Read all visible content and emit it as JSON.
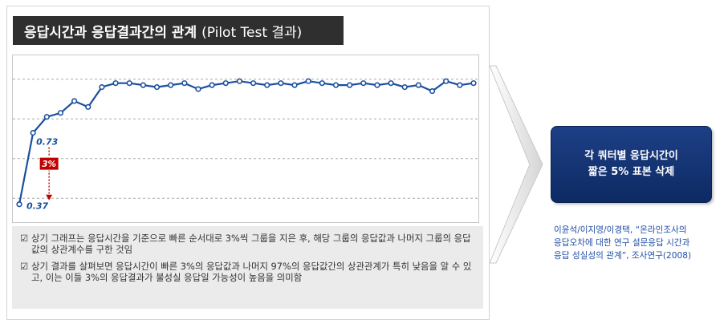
{
  "title": {
    "main": "응답시간과 응답결과간의 관계",
    "sub": "(Pilot Test 결과)"
  },
  "chart_data": {
    "type": "line",
    "x": [
      1,
      2,
      3,
      4,
      5,
      6,
      7,
      8,
      9,
      10,
      11,
      12,
      13,
      14,
      15,
      16,
      17,
      18,
      19,
      20,
      21,
      22,
      23,
      24,
      25,
      26,
      27,
      28,
      29,
      30,
      31,
      32,
      33,
      34
    ],
    "series": [
      {
        "values": [
          0.37,
          0.73,
          0.81,
          0.83,
          0.89,
          0.86,
          0.96,
          0.98,
          0.98,
          0.97,
          0.96,
          0.97,
          0.98,
          0.95,
          0.97,
          0.98,
          0.99,
          0.98,
          0.97,
          0.98,
          0.97,
          0.99,
          0.98,
          0.97,
          0.97,
          0.98,
          0.97,
          0.98,
          0.96,
          0.97,
          0.94,
          0.99,
          0.97,
          0.98
        ],
        "color": "#1a4f9e"
      }
    ],
    "ylim": [
      0.28,
      1.12
    ],
    "grid": true,
    "annotations": [
      {
        "x": 2,
        "label": "0.73"
      },
      {
        "x": 1,
        "label": "0.37"
      },
      {
        "label": "3%"
      }
    ]
  },
  "notes": [
    {
      "mark": "☑",
      "text": "상기 그래프는 응답시간을 기준으로 빠른 순서대로 3%씩 그룹을 지은 후, 해당 그룹의 응답값과 나머지 그룹의 응답값의 상관계수를 구한 것임"
    },
    {
      "mark": "☑",
      "text": "상기 결과를 살펴보면 응답시간이 빠른 3%의 응답값과 나머지 97%의 응답값간의 상관관계가 특히 낮음을 알 수 있고, 이는 이들 3%의 응답결과가 불성실 응답일 가능성이 높음을 의미함"
    }
  ],
  "result": {
    "line1": "각 쿼터별 응답시간이",
    "line2": "짧은 5% 표본 삭제"
  },
  "citation": {
    "line1": "이윤석/이지영/이경택, “온라인조사의",
    "line2": "응답오차에 대한 연구 설문응답 시간과",
    "line3": "응답 성실성의 관계”, 조사연구(2008)"
  },
  "colors": {
    "line": "#1a4f9e",
    "badge": "#c00000",
    "result_bg": "#163a7c",
    "citation": "#1f4ea6"
  }
}
